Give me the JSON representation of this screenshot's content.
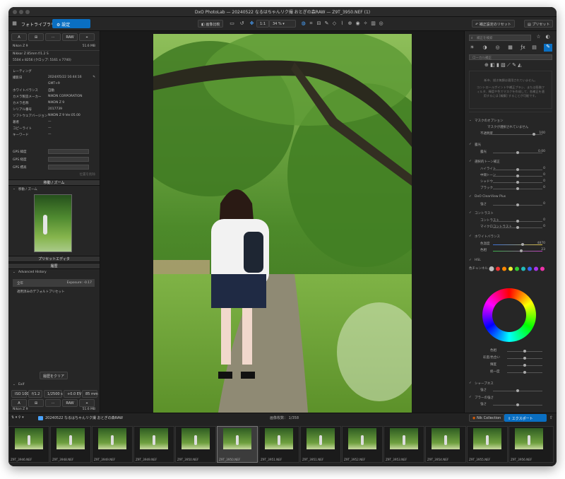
{
  "window": {
    "title": "DxO PhotoLab — 20240522 なるはちゃんリク撮 おとぎの森RAW — Z9T_3950.NEF (1)"
  },
  "tabs": [
    "フォトライブラリ",
    "設定"
  ],
  "toolbar": {
    "compare": "画像比較",
    "one_to_one": "1:1",
    "zoom": "34 %",
    "reset": "補正設定のリセット",
    "preset": "プリセット"
  },
  "left": {
    "quick": [
      "A",
      "",
      "···",
      "RAW",
      ""
    ],
    "camera": "Nikon Z 9",
    "size": "51.6 MB",
    "lens": "Nikkor Z 85mm f/1.2 S",
    "dims": "5504 x 8256 (クロップ: 5161 x 7740)",
    "meta": [
      [
        "レーティング",
        ""
      ],
      [
        "撮影日",
        "2024/05/22 16:44:16"
      ],
      [
        "",
        "GMT+9"
      ],
      [
        "ホワイトバランス",
        "自動"
      ],
      [
        "カメラ製造メーカー",
        "NIKON CORPORATION"
      ],
      [
        "カメラ名称",
        "NIKON Z 9"
      ],
      [
        "シリアル番号",
        "2017739"
      ],
      [
        "ソフトウェアバージョン",
        "NIKON Z 9 Ver.05.00"
      ],
      [
        "著者",
        "—"
      ],
      [
        "コピーライト",
        "—"
      ],
      [
        "キーワード",
        "—"
      ]
    ],
    "gps": [
      "GPS 緯度",
      "GPS 経度",
      "GPS 標高"
    ],
    "gps_footer": "位置を削除",
    "nav_header": "移動 / ズーム",
    "nav_sub": "移動 / ズーム",
    "preset_editor": "プリセットエディタ",
    "history_header": "履歴",
    "adv_history": "Advanced History",
    "history": [
      [
        "全年",
        "Exposure: -0.17"
      ],
      [
        "適用済みのデフォルトプリセット",
        ""
      ]
    ],
    "clear_history": "履歴をクリア",
    "exif_header": "Exif",
    "exif": [
      "ISO 100",
      "f/1.2",
      "1/2500 s",
      "+0.0 EV",
      "85 mm"
    ]
  },
  "right": {
    "search": "補正を検索",
    "placeholder": "ローカル補正",
    "note1": "新市、描き無類は適用されていません。",
    "note2": "コントロールポイントや補正ブラシ、または段階フィルタ、輝度や色でマスクを作成して、各補正を適用するには [編集] することが可能です。",
    "mask": "マスクのオプション",
    "mask_note": "マスクが選択されていません",
    "opacity": "不透明度",
    "opacity_val": "100",
    "panels": [
      [
        "露光",
        "露光",
        "0.00"
      ],
      [
        "選択的トーン補正",
        "ハイライト",
        "0"
      ],
      [
        "",
        "中間トーン",
        "0"
      ],
      [
        "",
        "シャドウ",
        "0"
      ],
      [
        "",
        "ブラック",
        "0"
      ],
      [
        "DxO ClearView Plus",
        "強さ",
        "0"
      ],
      [
        "コントラスト",
        "コントラスト",
        "0"
      ],
      [
        "",
        "マイクロコントラスト",
        "0"
      ],
      [
        "ホワイトバランス",
        "色温度",
        "4870"
      ],
      [
        "",
        "色相",
        "23"
      ]
    ],
    "hsl": "HSL",
    "color_channel": "色チャンネル",
    "hsl_sliders": [
      "色相",
      "彩度/色合い",
      "輝度",
      "統一度"
    ],
    "sharpen": "シャープネス",
    "sharpen_row": "強さ",
    "blur": "ブラーの強さ",
    "blur_row": "強さ"
  },
  "filmstrip": {
    "folder": "20240522 なるはちゃんリク撮 おとぎの森RAW",
    "count_label": "画像枚数：",
    "count": "1/358",
    "nik": "Nik Collection",
    "export": "エクスポート",
    "files": [
      "Z9T_3946.NEF",
      "Z9T_3948.NEF",
      "Z9T_3949.NEF",
      "Z9T_3949.NEF",
      "Z9T_3950.NEF",
      "Z9T_3950.NEF",
      "Z9T_3951.NEF",
      "Z9T_3951.NEF",
      "Z9T_3952.NEF",
      "Z9T_3953.NEF",
      "Z9T_3954.NEF",
      "Z9T_3955.NEF",
      "Z9T_3956.NEF"
    ],
    "selected_index": 5
  },
  "colors": {
    "accent": "#0a6fc2",
    "bg": "#1c1c1c",
    "panel": "#262626"
  }
}
